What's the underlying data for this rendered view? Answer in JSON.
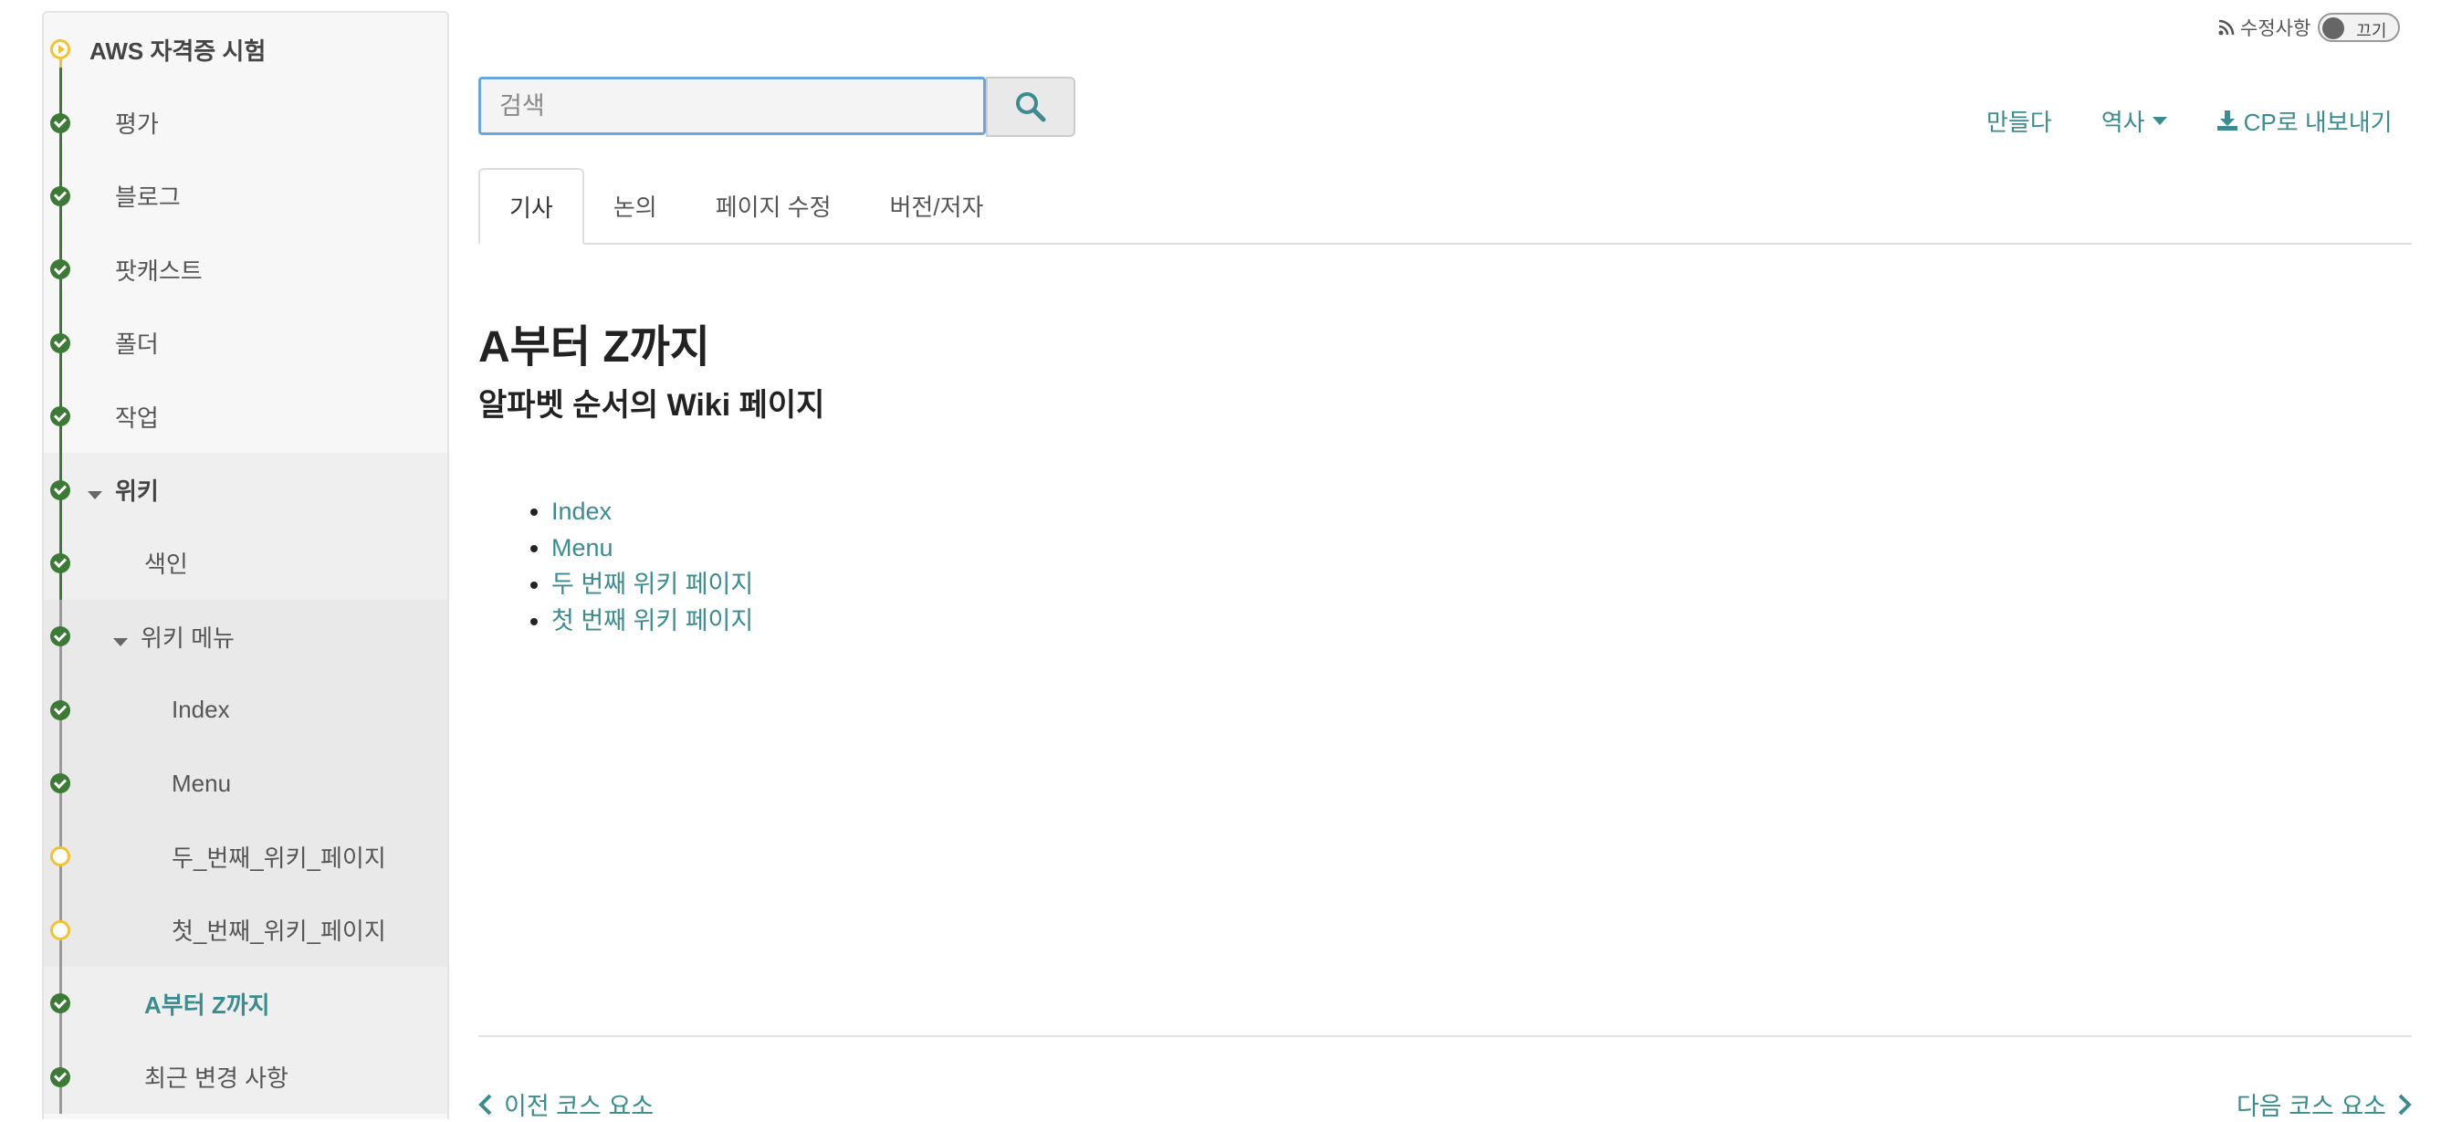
{
  "sidebar": {
    "course_title": "AWS 자격증 시험",
    "items": [
      {
        "label": "평가",
        "status": "done"
      },
      {
        "label": "블로그",
        "status": "done"
      },
      {
        "label": "팟캐스트",
        "status": "done"
      },
      {
        "label": "폴더",
        "status": "done"
      },
      {
        "label": "작업",
        "status": "done"
      },
      {
        "label": "위키",
        "status": "done",
        "expanded": true
      },
      {
        "label": "색인",
        "status": "done"
      },
      {
        "label": "위키 메뉴",
        "status": "done",
        "expanded": true
      },
      {
        "label": "Index",
        "status": "done"
      },
      {
        "label": "Menu",
        "status": "done"
      },
      {
        "label": "두_번째_위키_페이지",
        "status": "incomplete"
      },
      {
        "label": "첫_번째_위키_페이지",
        "status": "incomplete"
      },
      {
        "label": "A부터 Z까지",
        "status": "done",
        "current": true
      },
      {
        "label": "최근 변경 사항",
        "status": "done"
      }
    ]
  },
  "changes": {
    "label": "수정사항",
    "toggle_label": "끄기",
    "enabled": false
  },
  "search": {
    "placeholder": "검색",
    "value": ""
  },
  "actions": {
    "create": "만들다",
    "history": "역사",
    "export": "CP로 내보내기"
  },
  "tabs": [
    {
      "label": "기사",
      "active": true
    },
    {
      "label": "논의",
      "active": false
    },
    {
      "label": "페이지 수정",
      "active": false
    },
    {
      "label": "버전/저자",
      "active": false
    }
  ],
  "article": {
    "title": "A부터 Z까지",
    "subtitle": "알파벳 순서의 Wiki 페이지",
    "links": [
      "Index",
      "Menu",
      "두 번째 위키 페이지",
      "첫 번째 위키 페이지"
    ]
  },
  "pager": {
    "prev": "이전 코스 요소",
    "next": "다음 코스 요소"
  },
  "colors": {
    "accent": "#3a8c8e",
    "done": "#3e7a37",
    "incomplete": "#f2c230",
    "focus": "#6aa5dd"
  }
}
